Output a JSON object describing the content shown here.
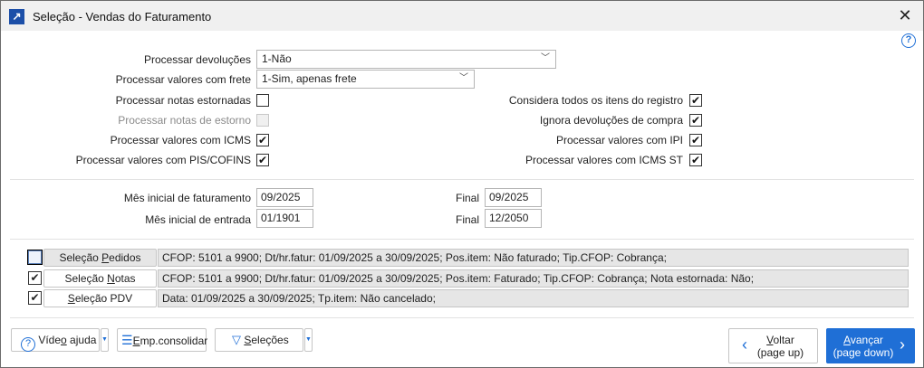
{
  "window": {
    "title": "Seleção - Vendas do Faturamento",
    "close": "✕",
    "help": "?"
  },
  "fields": {
    "devolucoes": {
      "label": "Processar devoluções",
      "value": "1-Não"
    },
    "frete": {
      "label": "Processar valores com frete",
      "value": "1-Sim, apenas frete"
    },
    "left_checks": [
      {
        "label": "Processar notas estornadas",
        "checked": false,
        "disabled": false
      },
      {
        "label": "Processar notas de estorno",
        "checked": false,
        "disabled": true
      },
      {
        "label": "Processar valores com ICMS",
        "checked": true,
        "disabled": false
      },
      {
        "label": "Processar valores com PIS/COFINS",
        "checked": true,
        "disabled": false
      }
    ],
    "right_checks": [
      {
        "label": "Considera todos os itens do registro",
        "checked": true
      },
      {
        "label": "Ignora devoluções de compra",
        "checked": true
      },
      {
        "label": "Processar valores com IPI",
        "checked": true
      },
      {
        "label": "Processar valores com ICMS ST",
        "checked": true
      }
    ],
    "mes_fat": {
      "label": "Mês inicial de faturamento",
      "value": "09/2025",
      "final_label": "Final",
      "final_value": "09/2025"
    },
    "mes_ent": {
      "label": "Mês inicial de entrada",
      "value": "01/1901",
      "final_label": "Final",
      "final_value": "12/2050"
    }
  },
  "selections": [
    {
      "checked": false,
      "pre": "Seleção ",
      "u": "P",
      "post": "edidos",
      "summary": "CFOP: 5101 a 9900; Dt/hr.fatur: 01/09/2025 a 30/09/2025; Pos.item: Não faturado; Tip.CFOP: Cobrança;"
    },
    {
      "checked": true,
      "pre": "Seleção ",
      "u": "N",
      "post": "otas",
      "summary": "CFOP: 5101 a 9900; Dt/hr.fatur: 01/09/2025 a 30/09/2025; Pos.item: Faturado; Tip.CFOP: Cobrança; Nota estornada: Não;"
    },
    {
      "checked": true,
      "pre": "",
      "u": "S",
      "post": "eleção PDV",
      "summary": "Data: 01/09/2025 a 30/09/2025; Tp.item: Não cancelado;"
    }
  ],
  "footer": {
    "video": {
      "pre": "Víde",
      "u": "o",
      "post": " ajuda"
    },
    "emp": {
      "u": "E",
      "post": "mp.consolidar"
    },
    "selecoes": {
      "u": "S",
      "post": "eleções"
    },
    "voltar": {
      "u": "V",
      "post": "oltar",
      "sub": "(page up)"
    },
    "avancar": {
      "u": "A",
      "post": "vançar",
      "sub": "(page down)"
    },
    "accent": "#1f6fd6"
  }
}
